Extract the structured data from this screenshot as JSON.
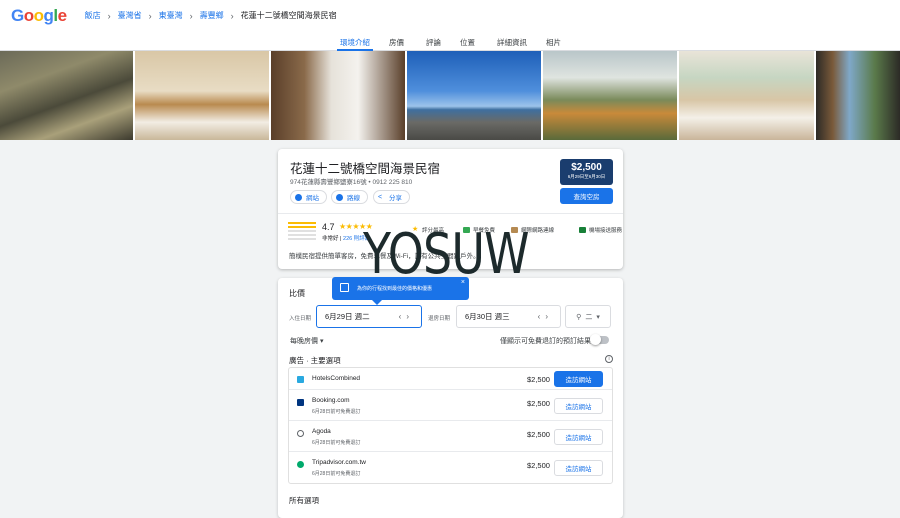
{
  "header": {
    "logo": "Google",
    "breadcrumbs": [
      {
        "label": "飯店"
      },
      {
        "label": "臺灣省"
      },
      {
        "label": "東臺灣"
      },
      {
        "label": "壽豐鄉"
      },
      {
        "label": "花蓮十二號橋空間海景民宿"
      }
    ]
  },
  "tabs": [
    "環境介紹",
    "房價",
    "評論",
    "位置",
    "詳細資訊",
    "相片"
  ],
  "hotel": {
    "name": "花蓮十二號橋空間海景民宿",
    "address": "974花蓮縣壽豐鄉鹽寮16號 • 0912 225 810",
    "actions": [
      "網站",
      "路線",
      "分享"
    ],
    "price": "$2,500",
    "price_dates": "6月29日至6月30日",
    "check_label": "查詢空房",
    "rating": "4.7",
    "stars": "★★★★★",
    "rating_word": "非常好",
    "review_count": "226 則評論",
    "amenities": [
      "評分最高",
      "早餐免費",
      "網際網路連線",
      "機場接送服務"
    ],
    "description": "簡樸民宿提供簡單客房，免費早餐及Wi-Fi，設有公共空間跟戶外。"
  },
  "watermark": "YOSUW",
  "compare": {
    "title": "比價",
    "tooltip": "為你的行程找到最佳的價格和優惠",
    "checkin_label": "入住日期",
    "checkin_value": "6月29日 週二",
    "checkout_label": "退房日期",
    "checkout_value": "6月30日 週三",
    "guests": "二",
    "nightly": "每晚房價",
    "free_cancel": "僅顯示可免費退訂的預訂結果",
    "ads_label": "廣告 · 主要選項",
    "providers": [
      {
        "name": "HotelsCombined",
        "sub": "",
        "price": "$2,500",
        "button": "造訪網站",
        "color": "#29a9e0"
      },
      {
        "name": "Booking.com",
        "sub": "6月28日前可免費退訂",
        "price": "$2,500",
        "button": "造訪網站",
        "color": "#003580"
      },
      {
        "name": "Agoda",
        "sub": "6月28日前可免費退訂",
        "price": "$2,500",
        "button": "造訪網站",
        "color": "#5f6368"
      },
      {
        "name": "Tripadvisor.com.tw",
        "sub": "6月28日前可免費退訂",
        "price": "$2,500",
        "button": "造訪網站",
        "color": "#34e0a1"
      }
    ],
    "all_options": "所有選項"
  }
}
